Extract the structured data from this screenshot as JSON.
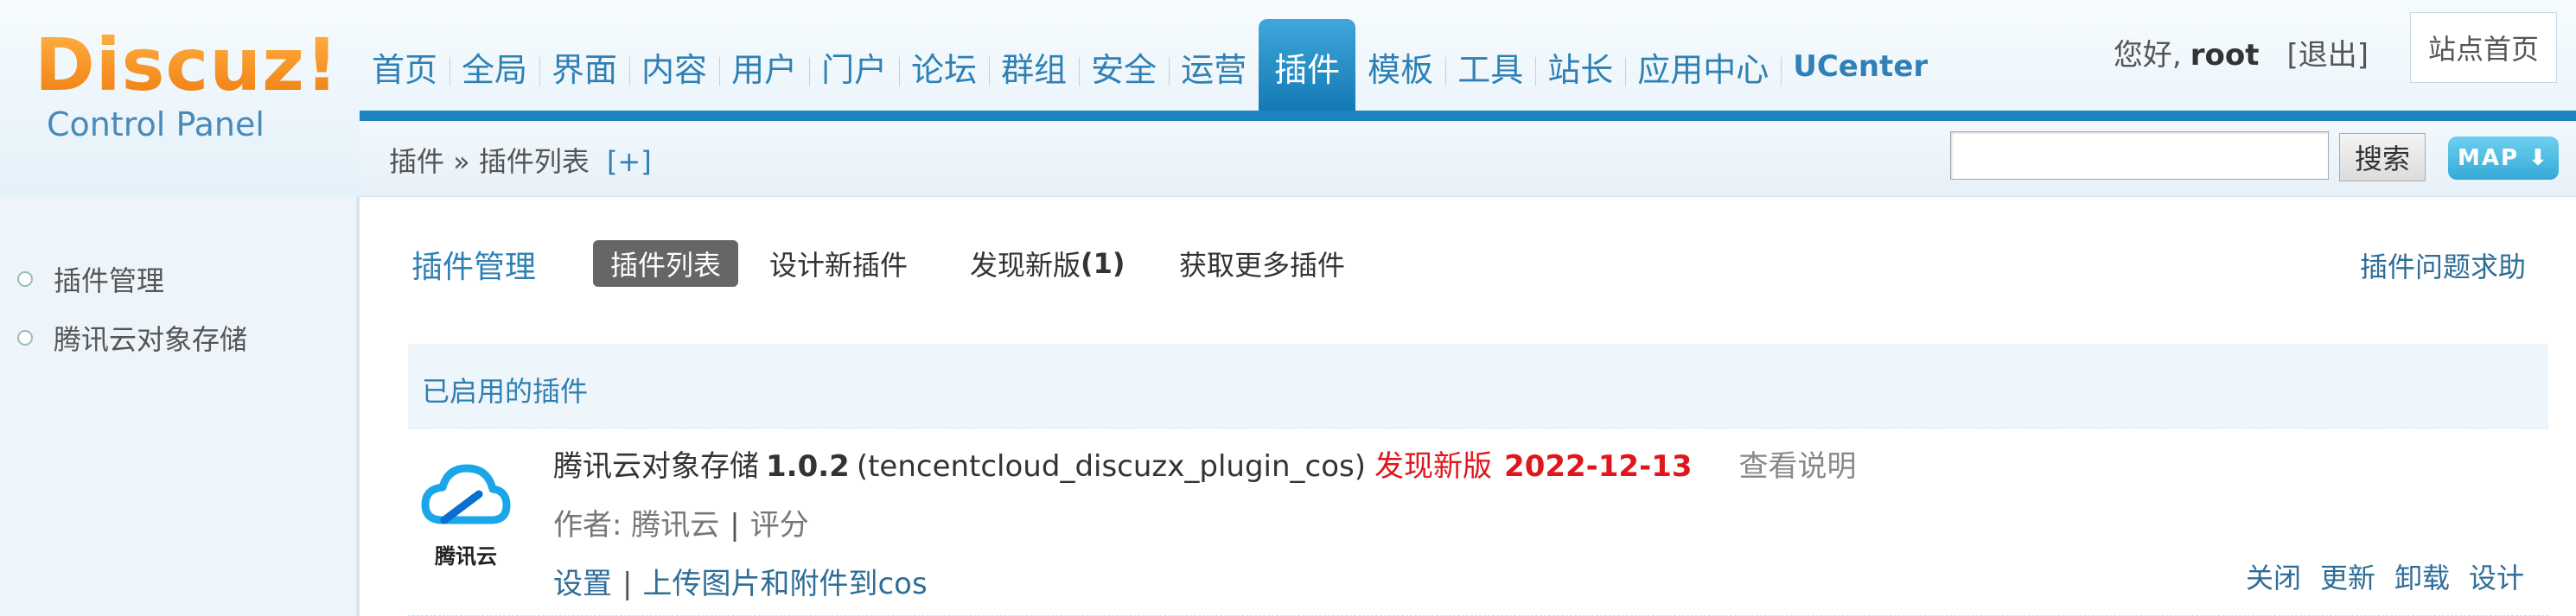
{
  "logo": {
    "brand": "Discuz!",
    "subtitle": "Control Panel"
  },
  "nav": [
    {
      "label": "首页",
      "name": "nav-home"
    },
    {
      "label": "全局",
      "name": "nav-global"
    },
    {
      "label": "界面",
      "name": "nav-interface"
    },
    {
      "label": "内容",
      "name": "nav-content"
    },
    {
      "label": "用户",
      "name": "nav-users"
    },
    {
      "label": "门户",
      "name": "nav-portal"
    },
    {
      "label": "论坛",
      "name": "nav-forum"
    },
    {
      "label": "群组",
      "name": "nav-groups"
    },
    {
      "label": "安全",
      "name": "nav-security"
    },
    {
      "label": "运营",
      "name": "nav-operations"
    },
    {
      "label": "插件",
      "name": "nav-plugins",
      "active": true
    },
    {
      "label": "模板",
      "name": "nav-templates"
    },
    {
      "label": "工具",
      "name": "nav-tools"
    },
    {
      "label": "站长",
      "name": "nav-webmaster"
    },
    {
      "label": "应用中心",
      "name": "nav-app-center"
    },
    {
      "label": "UCenter",
      "name": "nav-ucenter"
    }
  ],
  "user": {
    "greeting": "您好,",
    "name": "root",
    "logout": "[退出]"
  },
  "site_home": "站点首页",
  "breadcrumb": {
    "text": "插件 » 插件列表",
    "plus": "[+]"
  },
  "search": {
    "button": "搜索",
    "value": ""
  },
  "map_button": "MAP ⬇",
  "sidebar": {
    "items": [
      {
        "label": "插件管理"
      },
      {
        "label": "腾讯云对象存储"
      }
    ]
  },
  "main": {
    "title": "插件管理",
    "tabs": [
      {
        "label": "插件列表",
        "current": true
      },
      {
        "label": "设计新插件"
      },
      {
        "label": "发现新版",
        "count": "(1)"
      },
      {
        "label": "获取更多插件"
      }
    ],
    "help": "插件问题求助",
    "section_title": "已启用的插件"
  },
  "plugin": {
    "icon_caption": "腾讯云",
    "name": "腾讯云对象存储",
    "version": "1.0.2",
    "identifier": "(tencentcloud_discuzx_plugin_cos)",
    "new_version_label": "发现新版",
    "new_version_date": "2022-12-13",
    "readme": "查看说明",
    "author_label": "作者: 腾讯云",
    "separator": "|",
    "rate": "评分",
    "settings": "设置",
    "upload_link": "上传图片和附件到cos",
    "actions": [
      "关闭",
      "更新",
      "卸载",
      "设计"
    ]
  },
  "colors": {
    "accent": "#1c85c2",
    "link": "#2f80b4",
    "alert": "#e0161d",
    "logo": "#f07c0f"
  }
}
